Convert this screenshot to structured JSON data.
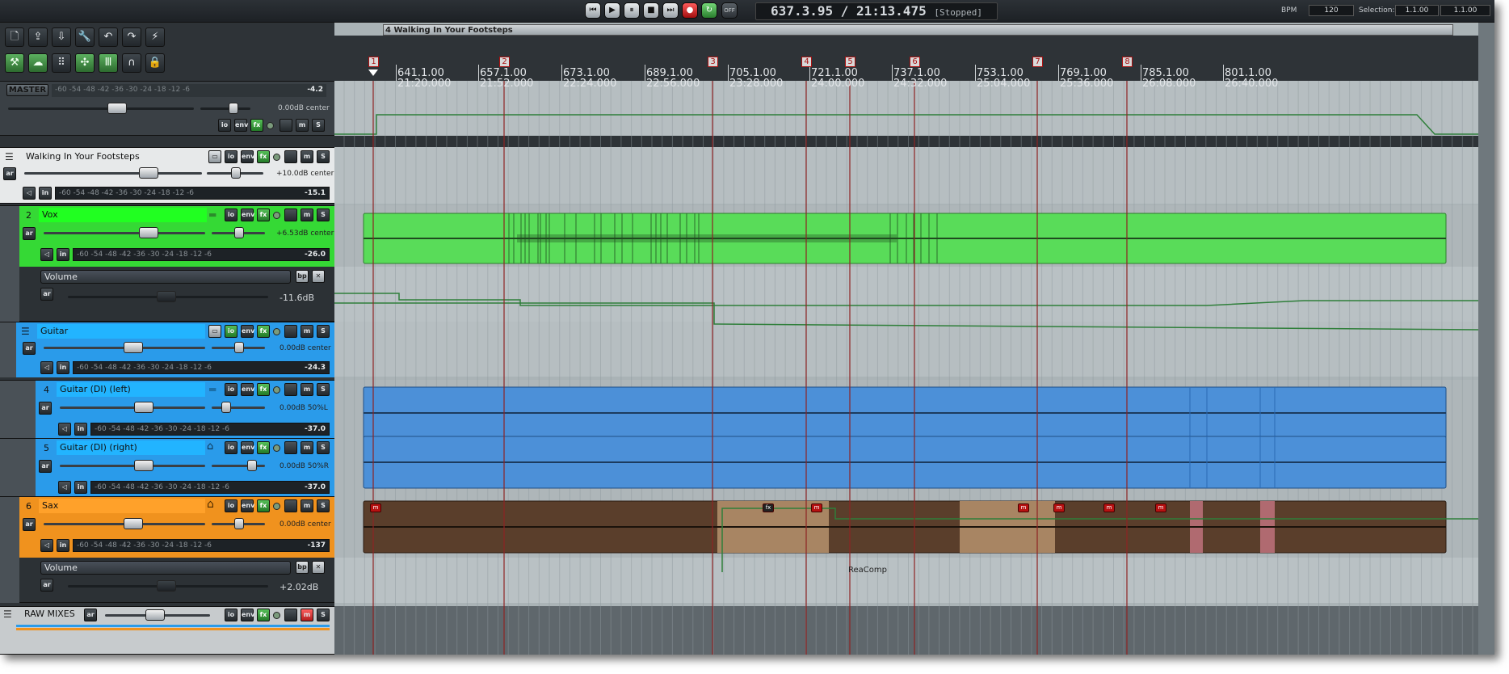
{
  "transport": {
    "buttons": [
      {
        "name": "go-to-start-button",
        "icon": "⏮"
      },
      {
        "name": "play-button",
        "icon": "▶"
      },
      {
        "name": "pause-button",
        "icon": "⏸"
      },
      {
        "name": "stop-button",
        "icon": "■"
      },
      {
        "name": "go-to-end-button",
        "icon": "⏭"
      },
      {
        "name": "record-button",
        "icon": "●"
      },
      {
        "name": "repeat-button",
        "icon": "↻"
      }
    ],
    "off_label": "OFF",
    "time": "637.3.95 / 21:13.475",
    "status": "[Stopped]",
    "bpm_label": "BPM",
    "bpm_value": "120",
    "selection_label": "Selection:",
    "selection_start": "1.1.00",
    "selection_end": "1.1.00"
  },
  "toolbar": {
    "row1": [
      "new-icon",
      "open-icon",
      "save-icon",
      "wrench-icon",
      "undo-icon",
      "redo-icon",
      "metronome-icon"
    ],
    "row1_glyphs": [
      "🗋",
      "⇪",
      "⇩",
      "🔧",
      "↶",
      "↷",
      "⚡"
    ],
    "row2": [
      "ripple-edit-icon",
      "group-icon",
      "grid-icon",
      "snap-icon",
      "bars-icon",
      "magnet-icon",
      "lock-icon"
    ],
    "row2_glyphs": [
      "⚒",
      "☁",
      "⠿",
      "✣",
      "Ⅲ",
      "∩",
      "🔒"
    ]
  },
  "master": {
    "label": "MASTER",
    "scale": "-60 -54 -48 -42 -36 -30 -24 -18 -12 -6",
    "peak": "-4.2",
    "volume": "0.00dB center",
    "buttons": {
      "io": "io",
      "env": "env",
      "fx": "fx",
      "m": "m",
      "s": "S"
    }
  },
  "tracks": [
    {
      "num": "",
      "name": "Walking In Your Footsteps",
      "color": "#e7e9ea",
      "volume": "+10.0dB center",
      "peak": "-15.1"
    },
    {
      "num": "2",
      "name": "Vox",
      "color": "#38d838",
      "volume": "+6.53dB center",
      "peak": "-26.0"
    },
    {
      "num": "",
      "name": "Guitar",
      "color": "#2a9bea",
      "volume": "0.00dB center",
      "peak": "-24.3"
    },
    {
      "num": "4",
      "name": "Guitar (DI) (left)",
      "color": "#2a9bea",
      "volume": "0.00dB 50%L",
      "peak": "-37.0"
    },
    {
      "num": "5",
      "name": "Guitar (DI) (right)",
      "color": "#2a9bea",
      "volume": "0.00dB 50%R",
      "peak": "-37.0"
    },
    {
      "num": "6",
      "name": "Sax",
      "color": "#f0921e",
      "volume": "0.00dB center",
      "peak": "-137"
    },
    {
      "num": "",
      "name": "RAW MIXES",
      "color": "#c7cbcd",
      "volume": "",
      "peak": ""
    }
  ],
  "envelopes": [
    {
      "name": "Volume",
      "value": "-11.6dB",
      "bp": "bp",
      "close": "✕"
    },
    {
      "name": "Volume",
      "value": "+2.02dB",
      "bp": "bp",
      "close": "✕"
    }
  ],
  "track_buttons": {
    "io": "io",
    "env": "env",
    "fx": "fx",
    "m": "m",
    "s": "S",
    "ar": "ar",
    "in": "in"
  },
  "arrange": {
    "project_title": "4 Walking In Your Footsteps",
    "ruler": [
      {
        "bar": "641.1.00",
        "time": "21:20.000"
      },
      {
        "bar": "657.1.00",
        "time": "21:52.000"
      },
      {
        "bar": "673.1.00",
        "time": "22:24.000"
      },
      {
        "bar": "689.1.00",
        "time": "22:56.000"
      },
      {
        "bar": "705.1.00",
        "time": "23:28.000"
      },
      {
        "bar": "721.1.00",
        "time": "24:00.000"
      },
      {
        "bar": "737.1.00",
        "time": "24:32.000"
      },
      {
        "bar": "753.1.00",
        "time": "25:04.000"
      },
      {
        "bar": "769.1.00",
        "time": "25:36.000"
      },
      {
        "bar": "785.1.00",
        "time": "26:08.000"
      },
      {
        "bar": "801.1.00",
        "time": "26:40.000"
      }
    ],
    "markers": [
      "1",
      "2",
      "3",
      "4",
      "5",
      "6",
      "7",
      "8"
    ],
    "sax_fx_label": "ReaComp",
    "fx_badge_text": "m",
    "fx_grey_text": "fx",
    "colors": {
      "vox_item": "#59dc59",
      "guitar_item": "#4c90d8",
      "sax_item": "#5a3e2b",
      "sax_selected": "#a88563",
      "envelope": "#2f7f3a",
      "marker_line": "#8e2323"
    }
  }
}
